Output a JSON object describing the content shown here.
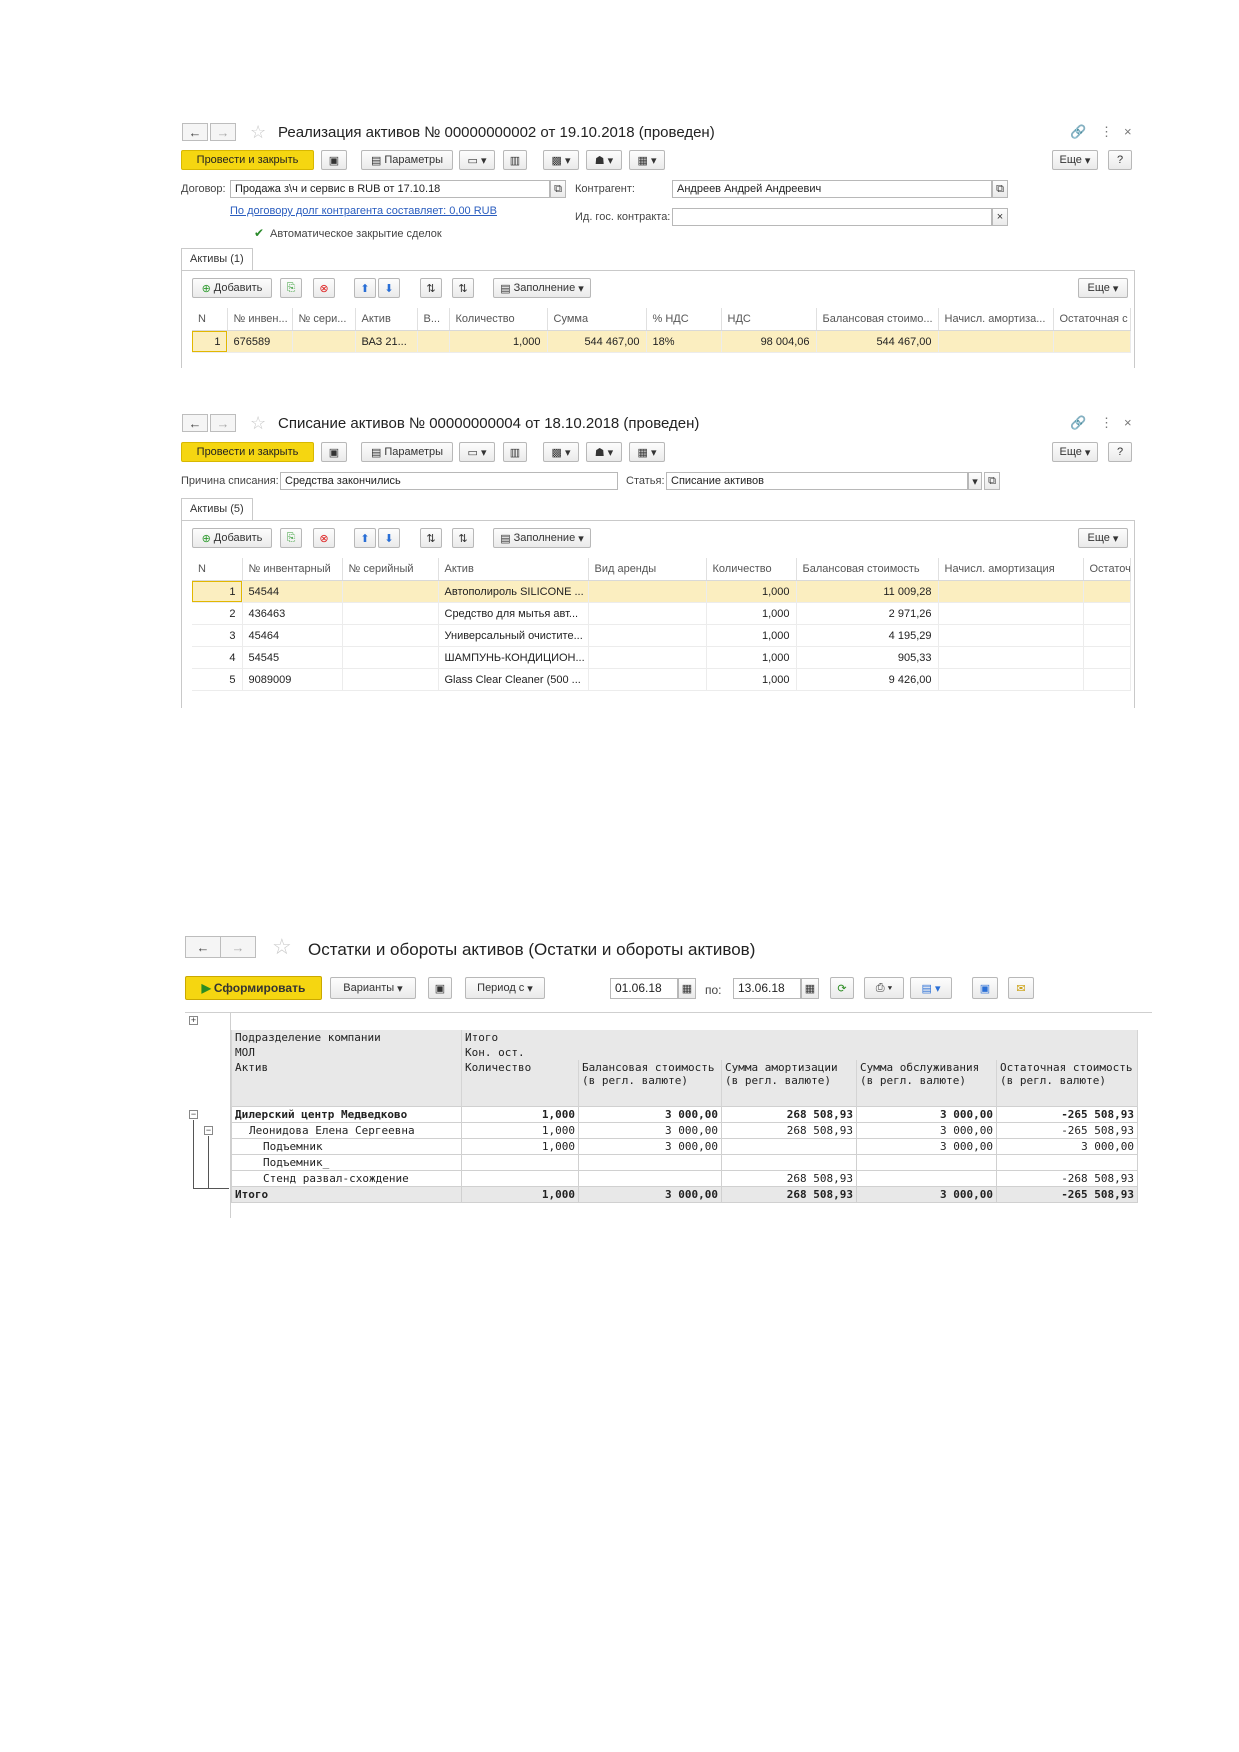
{
  "doc1": {
    "title": "Реализация активов № 00000000002 от 19.10.2018 (проведен)",
    "post_close": "Провести и закрыть",
    "params": "Параметры",
    "more": "Еще",
    "help": "?",
    "contract_label": "Договор:",
    "contract_value": "Продажа з\\ч и сервис в RUB от 17.10.18",
    "debt_link": "По договору долг контрагента составляет: 0,00 RUB",
    "auto_close": "Автоматическое закрытие сделок",
    "counterparty_label": "Контрагент:",
    "counterparty_value": "Андреев Андрей Андреевич",
    "gov_label": "Ид. гос. контракта:",
    "gov_value": "",
    "tab": "Активы (1)",
    "add": "Добавить",
    "fill": "Заполнение",
    "table_more": "Еще",
    "columns": [
      "N",
      "№ инвен...",
      "№ сери...",
      "Актив",
      "В...",
      "Количество",
      "Сумма",
      "% НДС",
      "НДС",
      "Балансовая стоимо...",
      "Начисл. амортиза...",
      "Остаточная с"
    ],
    "rows": [
      [
        "1",
        "676589",
        "",
        "ВАЗ 21...",
        "",
        "1,000",
        "544 467,00",
        "18%",
        "98 004,06",
        "544 467,00",
        "",
        ""
      ]
    ]
  },
  "doc2": {
    "title": "Списание активов № 00000000004 от 18.10.2018 (проведен)",
    "post_close": "Провести и закрыть",
    "params": "Параметры",
    "more": "Еще",
    "help": "?",
    "reason_label": "Причина списания:",
    "reason_value": "Средства закончились",
    "article_label": "Статья:",
    "article_value": "Списание активов",
    "tab": "Активы (5)",
    "add": "Добавить",
    "fill": "Заполнение",
    "table_more": "Еще",
    "columns": [
      "N",
      "№ инвентарный",
      "№ серийный",
      "Актив",
      "Вид аренды",
      "Количество",
      "Балансовая стоимость",
      "Начисл. амортизация",
      "Остаточ"
    ],
    "rows": [
      [
        "1",
        "54544",
        "",
        "Автополироль SILICONE ...",
        "",
        "1,000",
        "11 009,28",
        "",
        ""
      ],
      [
        "2",
        "436463",
        "",
        "Средство для мытья авт...",
        "",
        "1,000",
        "2 971,26",
        "",
        ""
      ],
      [
        "3",
        "45464",
        "",
        "Универсальный очистите...",
        "",
        "1,000",
        "4 195,29",
        "",
        ""
      ],
      [
        "4",
        "54545",
        "",
        "ШАМПУНЬ-КОНДИЦИОН...",
        "",
        "1,000",
        "905,33",
        "",
        ""
      ],
      [
        "5",
        "9089009",
        "",
        "Glass Clear Cleaner (500 ...",
        "",
        "1,000",
        "9 426,00",
        "",
        ""
      ]
    ]
  },
  "report": {
    "title": "Остатки и обороты активов (Остатки и обороты активов)",
    "generate": "Сформировать",
    "variants": "Варианты",
    "period": "Период с",
    "date_from": "01.06.18",
    "to_label": "по:",
    "date_to": "13.06.18",
    "header": {
      "r1c1": "Подразделение компании",
      "r1c2": "Итого",
      "r2c1": "МОЛ",
      "r2c2": "Кон. ост.",
      "r3c1": "Актив",
      "cols": [
        "Количество",
        "Балансовая стоимость (в регл. валюте)",
        "Сумма амортизации (в регл. валюте)",
        "Сумма обслуживания (в регл. валюте)",
        "Остаточная стоимость (в регл. валюте)"
      ]
    },
    "rows": [
      {
        "name": "Дилерский центр Медведково",
        "vals": [
          "1,000",
          "3 000,00",
          "268 508,93",
          "3 000,00",
          "-265 508,93"
        ],
        "style": "bold",
        "indent": 0
      },
      {
        "name": "Леонидова Елена Сергеевна",
        "vals": [
          "1,000",
          "3 000,00",
          "268 508,93",
          "3 000,00",
          "-265 508,93"
        ],
        "style": "",
        "indent": 1
      },
      {
        "name": "Подъемник",
        "vals": [
          "1,000",
          "3 000,00",
          "",
          "3 000,00",
          "3 000,00"
        ],
        "style": "",
        "indent": 2
      },
      {
        "name": "Подъемник_",
        "vals": [
          "",
          "",
          "",
          "",
          ""
        ],
        "style": "",
        "indent": 2
      },
      {
        "name": "Стенд развал-схождение",
        "vals": [
          "",
          "",
          "268 508,93",
          "",
          "-268 508,93"
        ],
        "style": "",
        "indent": 2
      }
    ],
    "total": {
      "name": "Итого",
      "vals": [
        "1,000",
        "3 000,00",
        "268 508,93",
        "3 000,00",
        "-265 508,93"
      ]
    }
  }
}
